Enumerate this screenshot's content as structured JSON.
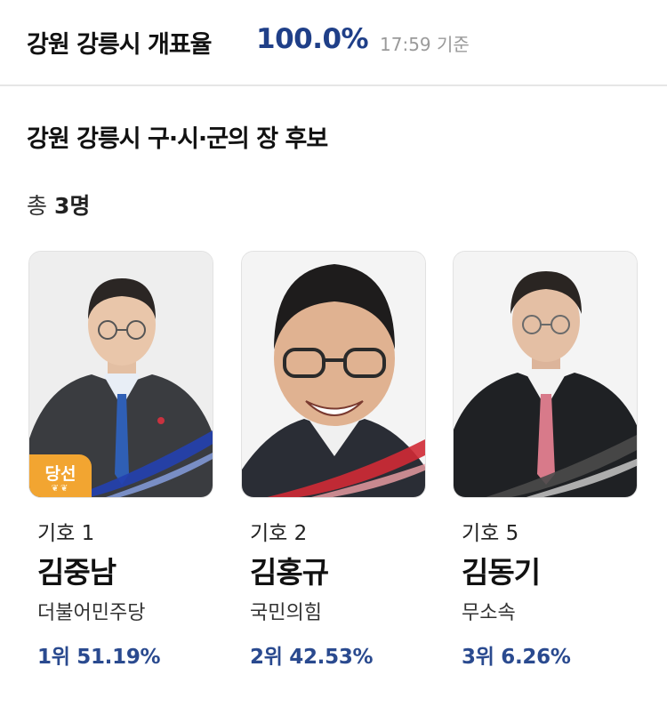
{
  "header": {
    "title": "강원 강릉시 개표율",
    "rate": "100.0%",
    "time": "17:59 기준"
  },
  "section": {
    "title": "강원 강릉시 구·시·군의 장 후보",
    "total_prefix": "총",
    "total_count": "3명"
  },
  "candidates": [
    {
      "symbol": "기호 1",
      "name": "김중남",
      "party": "더불어민주당",
      "result": "1위 51.19%",
      "badge": "당선",
      "tie_color": "#2f5fb5",
      "band_color": "#2340b0"
    },
    {
      "symbol": "기호 2",
      "name": "김홍규",
      "party": "국민의힘",
      "result": "2위 42.53%",
      "tie_color": "#c9323f",
      "band_color": "#d02a35"
    },
    {
      "symbol": "기호 5",
      "name": "김동기",
      "party": "무소속",
      "result": "3위 6.26%",
      "tie_color": "#d87a8a",
      "band_color": "#4a4a4a"
    }
  ]
}
